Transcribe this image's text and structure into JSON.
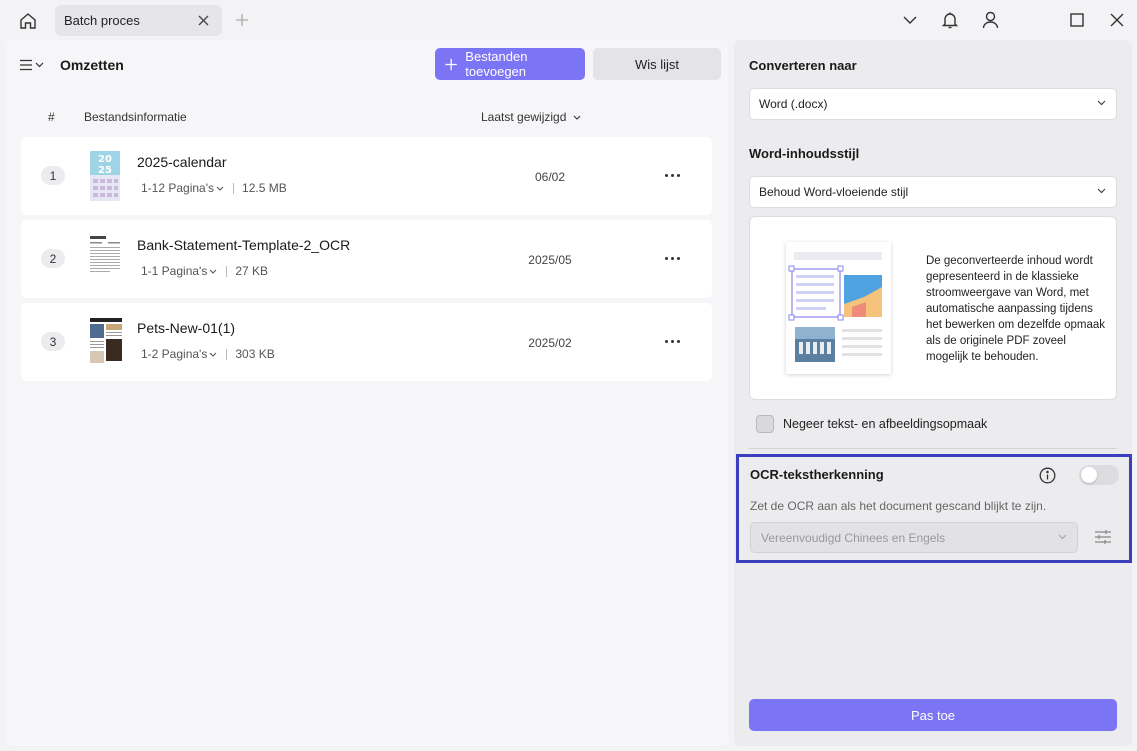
{
  "titlebar": {
    "tab_title": "Batch proces",
    "icons": [
      "home-icon",
      "close-icon",
      "plus-icon",
      "chevron-down-icon",
      "bell-icon",
      "user-icon",
      "maximize-icon",
      "window-close-icon"
    ]
  },
  "left": {
    "title": "Omzetten",
    "add_label": "Bestanden toevoegen",
    "clear_label": "Wis lijst",
    "columns": {
      "num": "#",
      "info": "Bestandsinformatie",
      "modified": "Laatst gewijzigd"
    },
    "files": [
      {
        "num": "1",
        "name": "2025-calendar",
        "pages": "1-12 Pagina's",
        "size": "12.5 MB",
        "date": "06/02"
      },
      {
        "num": "2",
        "name": "Bank-Statement-Template-2_OCR",
        "pages": "1-1 Pagina's",
        "size": "27 KB",
        "date": "2025/05"
      },
      {
        "num": "3",
        "name": "Pets-New-01(1)",
        "pages": "1-2 Pagina's",
        "size": "303 KB",
        "date": "2025/02"
      }
    ]
  },
  "right": {
    "convert_label": "Converteren naar",
    "convert_value": "Word (.docx)",
    "style_label": "Word-inhoudsstijl",
    "style_value": "Behoud Word-vloeiende stijl",
    "preview_text": "De geconverteerde inhoud wordt gepresenteerd in de klassieke stroomweergave van Word, met automatische aanpassing tijdens het bewerken om dezelfde opmaak als de originele PDF zoveel mogelijk te behouden.",
    "ignore_label": "Negeer tekst- en afbeeldingsopmaak",
    "ocr": {
      "title": "OCR-tekstherkenning",
      "hint": "Zet de OCR aan als het document gescand blijkt te zijn.",
      "language": "Vereenvoudigd Chinees en Engels",
      "enabled": false
    },
    "apply_label": "Pas toe"
  },
  "colors": {
    "accent": "#7b74f5",
    "highlight": "#3b3fbf",
    "background": "#f3f3f5"
  }
}
